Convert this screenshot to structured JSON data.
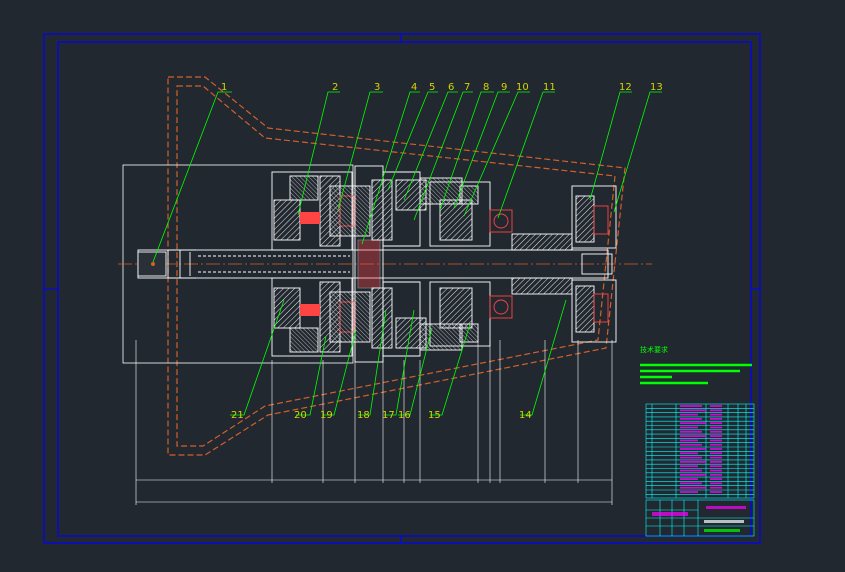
{
  "drawing": {
    "part_labels": [
      "1",
      "2",
      "3",
      "4",
      "5",
      "6",
      "7",
      "8",
      "9",
      "10",
      "11",
      "12",
      "13",
      "14",
      "15",
      "16",
      "17",
      "18",
      "19",
      "20",
      "21"
    ],
    "tech_req_title": "技术要求",
    "colors": {
      "background": "#212830",
      "border": "#0000ff",
      "outline": "#ffffff",
      "leader": "#00ff00",
      "label": "#d4d400",
      "housing": "#d2602a",
      "hatch": "#e8e8e8",
      "table_line": "#00ffff",
      "table_text": "#ff00ff"
    }
  }
}
